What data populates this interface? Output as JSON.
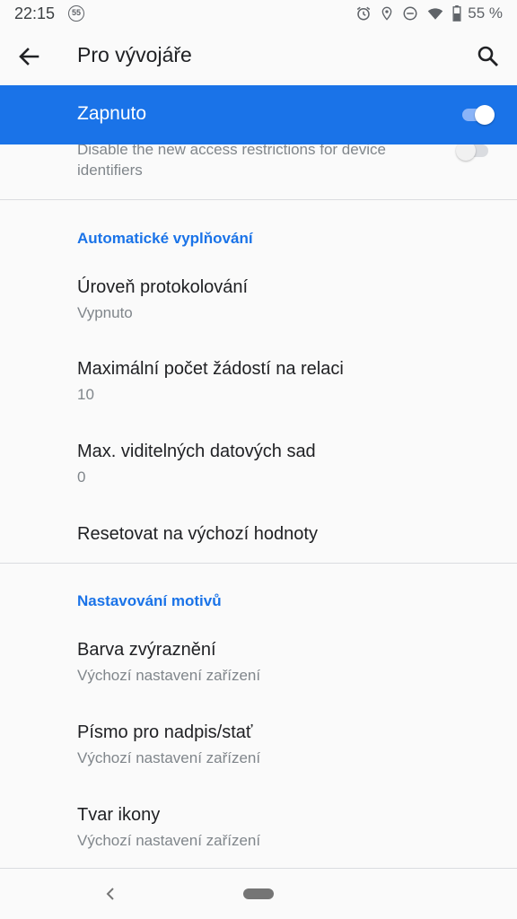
{
  "status_bar": {
    "time": "22:15",
    "badge": "55",
    "battery": "55 %",
    "icons": [
      "alarm-icon",
      "location-icon",
      "do-not-disturb-icon",
      "wifi-icon",
      "battery-icon"
    ]
  },
  "app_bar": {
    "title": "Pro vývojáře",
    "back_icon": "arrow-back-icon",
    "search_icon": "search-icon"
  },
  "master_switch": {
    "label": "Zapnuto",
    "checked": true,
    "accent": "#1a73e8"
  },
  "partial_item": {
    "text": "Disable the new access restrictions for device identifiers",
    "checked": false
  },
  "sections": [
    {
      "header": "Automatické vyplňování",
      "items": [
        {
          "title": "Úroveň protokolování",
          "summary": "Vypnuto"
        },
        {
          "title": "Maximální počet žádostí na relaci",
          "summary": "10"
        },
        {
          "title": "Max. viditelných datových sad",
          "summary": "0"
        },
        {
          "title": "Resetovat na výchozí hodnoty",
          "summary": ""
        }
      ]
    },
    {
      "header": "Nastavování motivů",
      "items": [
        {
          "title": "Barva zvýraznění",
          "summary": "Výchozí nastavení zařízení"
        },
        {
          "title": "Písmo pro nadpis/stať",
          "summary": "Výchozí nastavení zařízení"
        },
        {
          "title": "Tvar ikony",
          "summary": "Výchozí nastavení zařízení"
        }
      ]
    }
  ]
}
